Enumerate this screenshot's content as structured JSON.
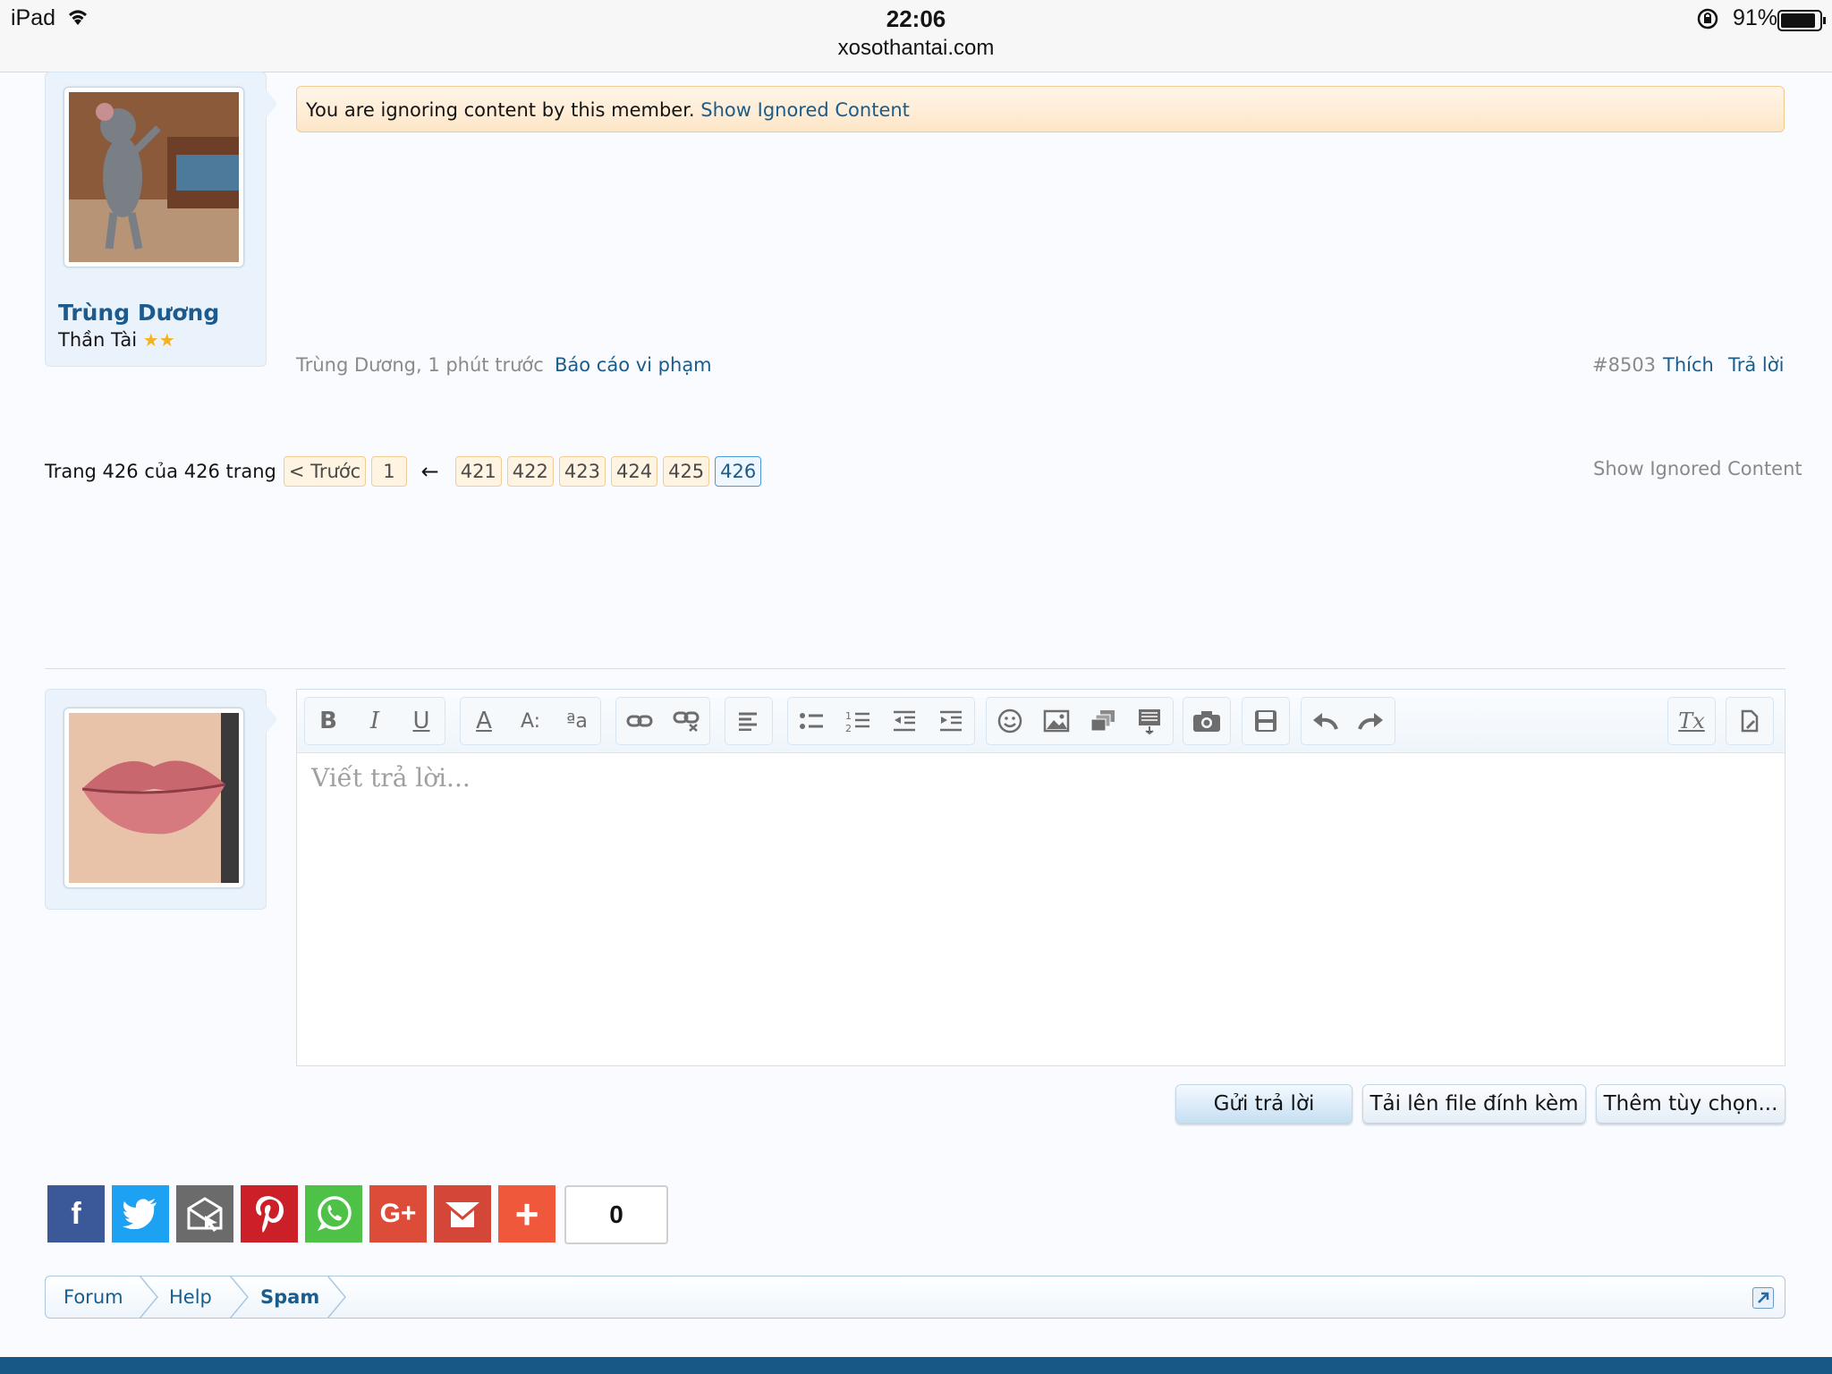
{
  "status_bar": {
    "device": "iPad",
    "time": "22:06",
    "url": "xosothantai.com",
    "battery": "91%"
  },
  "post": {
    "username": "Trùng Dương",
    "user_title": "Thần Tài",
    "user_stars": "★★",
    "ignored_text": "You are ignoring content by this member.",
    "show_ignored_link": "Show Ignored Content",
    "author_time": "Trùng Dương, 1 phút trước",
    "report": "Báo cáo vi phạm",
    "post_number": "#8503",
    "like": "Thích",
    "reply": "Trả lời"
  },
  "pagination": {
    "summary": "Trang 426 của 426 trang",
    "prev": "< Trước",
    "first": "1",
    "ellipsis_arrow": "←",
    "pages": [
      "421",
      "422",
      "423",
      "424",
      "425",
      "426"
    ],
    "current": "426",
    "show_ignored": "Show Ignored Content"
  },
  "editor": {
    "placeholder": "Viết trả lời...",
    "toolbar": {
      "bold": "B",
      "italic": "I",
      "underline": "U",
      "font_color": "A",
      "font_size": "A:",
      "font_family": "ªa",
      "remove_format": "Tx"
    }
  },
  "actions": {
    "submit": "Gửi trả lời",
    "upload": "Tải lên file đính kèm",
    "more": "Thêm tùy chọn..."
  },
  "share": {
    "count": "0",
    "icons": [
      "facebook-icon",
      "twitter-icon",
      "email-icon",
      "pinterest-icon",
      "whatsapp-icon",
      "google-plus-icon",
      "gmail-icon",
      "more-share-icon"
    ],
    "colors": {
      "facebook": "#3b5998",
      "twitter": "#1da1f2",
      "email": "#6b6b6b",
      "pinterest": "#cb2027",
      "whatsapp": "#4dc247",
      "googleplus": "#dd4b39",
      "gmail": "#d44638",
      "more": "#f0583c"
    }
  },
  "breadcrumb": {
    "items": [
      "Forum",
      "Help",
      "Spam"
    ]
  },
  "colors": {
    "accent": "#1a5c8a",
    "footer": "#185887"
  }
}
